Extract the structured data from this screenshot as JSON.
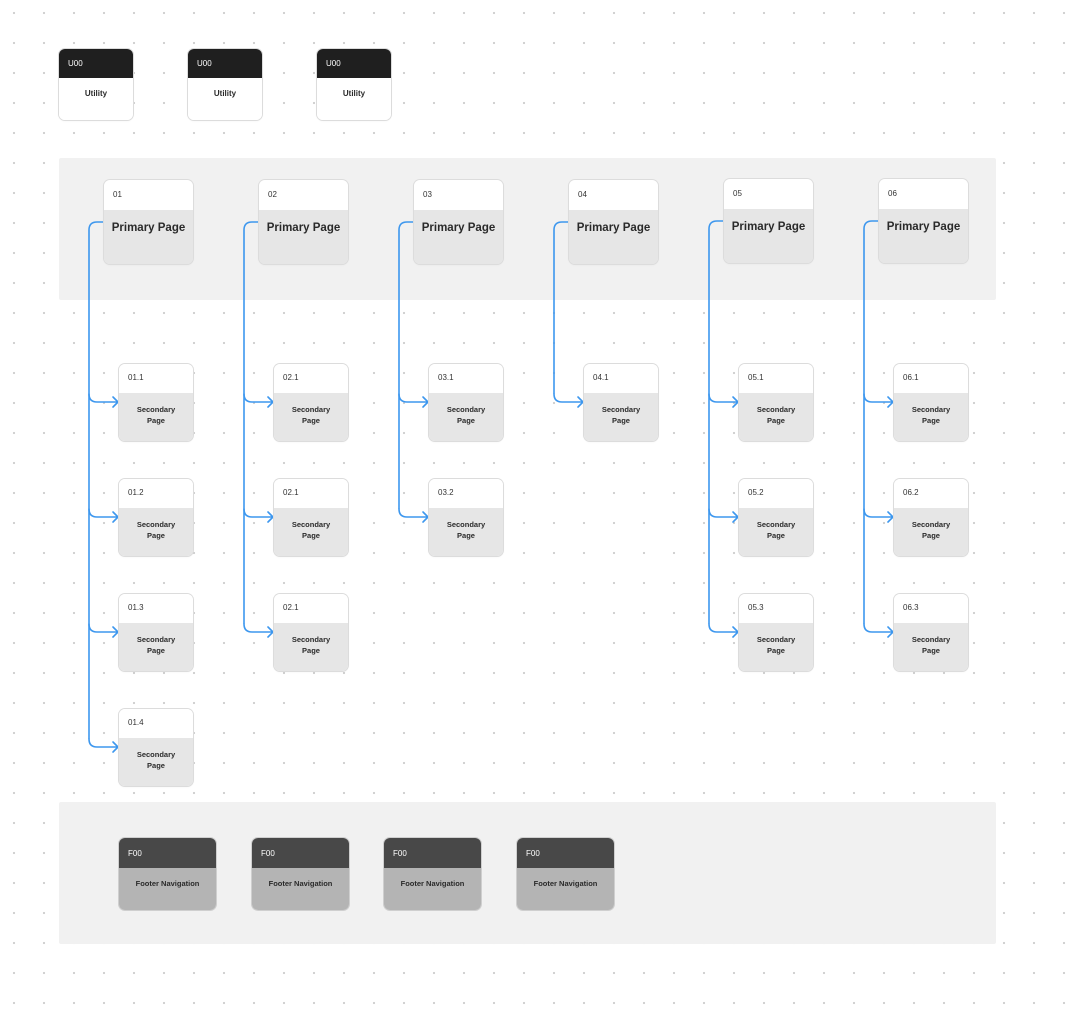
{
  "colors": {
    "connector": "#3d97ee",
    "utility_header": "#1f1f1f",
    "footer_header": "#484848",
    "footer_body": "#b4b4b4",
    "page_body": "#e6e6e6",
    "band": "#f1f1f1"
  },
  "utility": [
    {
      "code": "U00",
      "label": "Utility"
    },
    {
      "code": "U00",
      "label": "Utility"
    },
    {
      "code": "U00",
      "label": "Utility"
    }
  ],
  "primary": [
    {
      "code": "01",
      "label": "Primary Page",
      "children": [
        {
          "code": "01.1",
          "label": "Secondary Page"
        },
        {
          "code": "01.2",
          "label": "Secondary Page"
        },
        {
          "code": "01.3",
          "label": "Secondary Page"
        },
        {
          "code": "01.4",
          "label": "Secondary Page"
        }
      ]
    },
    {
      "code": "02",
      "label": "Primary Page",
      "children": [
        {
          "code": "02.1",
          "label": "Secondary Page"
        },
        {
          "code": "02.1",
          "label": "Secondary Page"
        },
        {
          "code": "02.1",
          "label": "Secondary Page"
        }
      ]
    },
    {
      "code": "03",
      "label": "Primary Page",
      "children": [
        {
          "code": "03.1",
          "label": "Secondary Page"
        },
        {
          "code": "03.2",
          "label": "Secondary Page"
        }
      ]
    },
    {
      "code": "04",
      "label": "Primary Page",
      "children": [
        {
          "code": "04.1",
          "label": "Secondary Page"
        }
      ]
    },
    {
      "code": "05",
      "label": "Primary Page",
      "children": [
        {
          "code": "05.1",
          "label": "Secondary Page"
        },
        {
          "code": "05.2",
          "label": "Secondary Page"
        },
        {
          "code": "05.3",
          "label": "Secondary Page"
        }
      ]
    },
    {
      "code": "06",
      "label": "Primary Page",
      "children": [
        {
          "code": "06.1",
          "label": "Secondary Page"
        },
        {
          "code": "06.2",
          "label": "Secondary Page"
        },
        {
          "code": "06.3",
          "label": "Secondary Page"
        }
      ]
    }
  ],
  "footer": [
    {
      "code": "F00",
      "label": "Footer Navigation"
    },
    {
      "code": "F00",
      "label": "Footer Navigation"
    },
    {
      "code": "F00",
      "label": "Footer Navigation"
    },
    {
      "code": "F00",
      "label": "Footer Navigation"
    }
  ]
}
